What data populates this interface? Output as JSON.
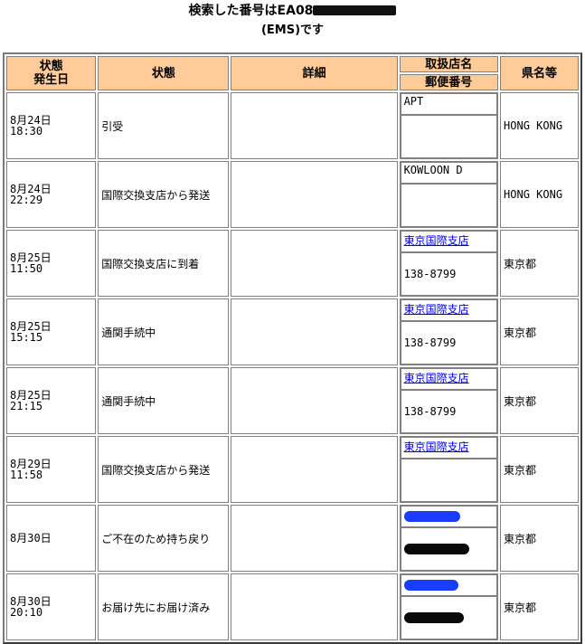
{
  "header": {
    "title": "検索した番号はEA08",
    "subtitle": "(EMS)です"
  },
  "table": {
    "columns": {
      "date": "状態発生日",
      "status": "状態",
      "detail": "詳細",
      "office": "取扱店名",
      "postcode": "郵便番号",
      "prefecture": "県名等"
    },
    "rows": [
      {
        "date1": "8月24日",
        "date2": "18:30",
        "status": "引受",
        "office": "APT",
        "postcode": "",
        "prefecture": "HONG KONG"
      },
      {
        "date1": "8月24日",
        "date2": "22:29",
        "status": "国際交換支店から発送",
        "office": "KOWLOON D",
        "postcode": "",
        "prefecture": "HONG KONG"
      },
      {
        "date1": "8月25日",
        "date2": "11:50",
        "status": "国際交換支店に到着",
        "office": "東京国際支店",
        "postcode": "138-8799",
        "prefecture": "東京都"
      },
      {
        "date1": "8月25日",
        "date2": "15:15",
        "status": "通関手続中",
        "office": "東京国際支店",
        "postcode": "138-8799",
        "prefecture": "東京都"
      },
      {
        "date1": "8月25日",
        "date2": "21:15",
        "status": "通関手続中",
        "office": "東京国際支店",
        "postcode": "138-8799",
        "prefecture": "東京都"
      },
      {
        "date1": "8月29日",
        "date2": "11:58",
        "status": "国際交換支店から発送",
        "office": "東京国際支店",
        "postcode": "",
        "prefecture": "東京都"
      },
      {
        "date1": "8月30日",
        "date2": "",
        "status": "ご不在のため持ち戻り",
        "office": "",
        "postcode": "",
        "prefecture": "東京都"
      },
      {
        "date1": "8月30日",
        "date2": "20:10",
        "status": "お届け先にお届け済み",
        "office": "",
        "postcode": "",
        "prefecture": "東京都"
      }
    ]
  }
}
